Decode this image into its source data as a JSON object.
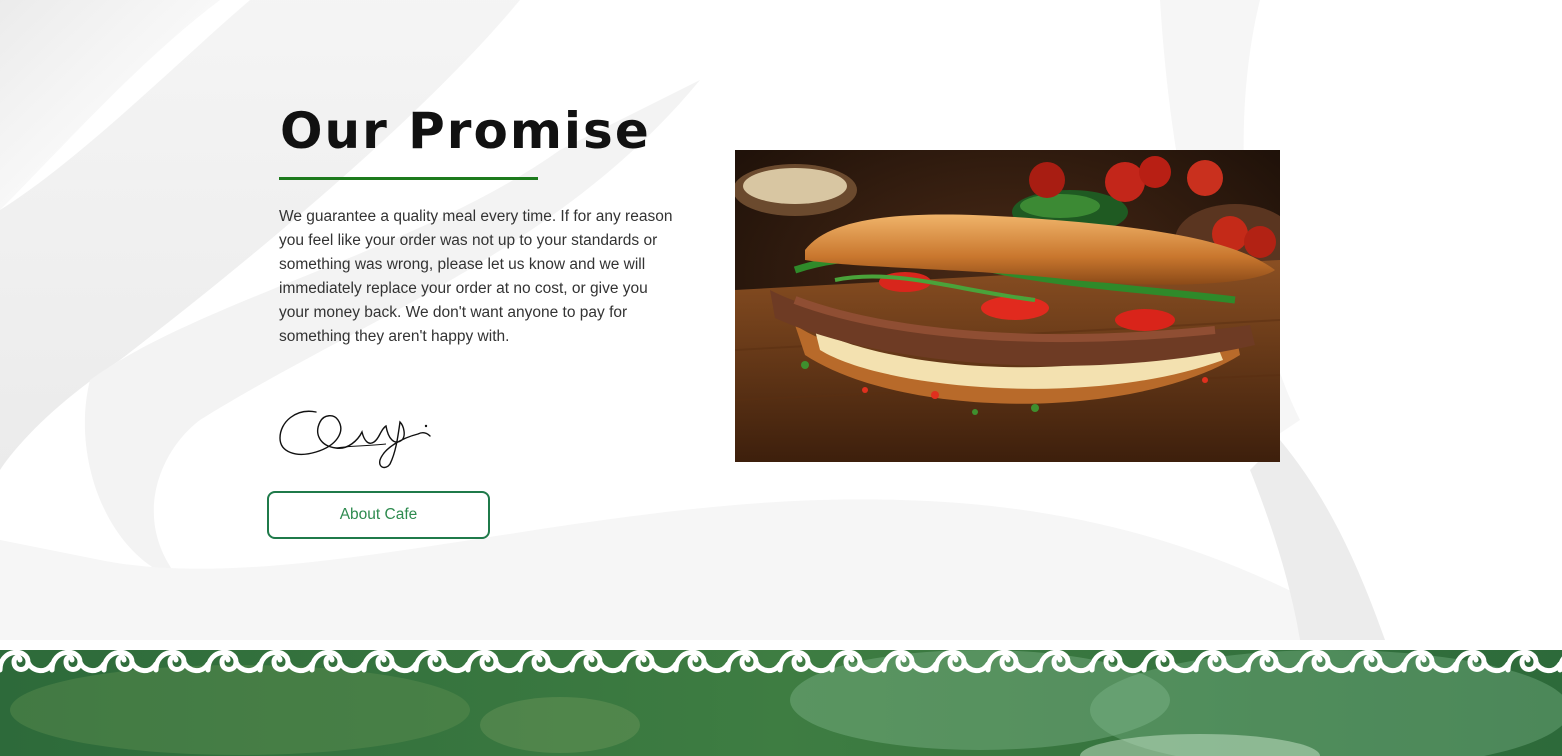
{
  "section": {
    "title": "Our Promise",
    "body": "We guarantee a quality meal every time. If for any reason you feel like your order was not up to your standards or something was wrong, please let us know and we will immediately replace your order at no cost, or give you your money back. We don't want anyone to pay for something they aren't happy with.",
    "signature": "Giovanni Salvia",
    "button_label": "About Cafe"
  },
  "image": {
    "subject": "steak and cheese sub sandwich on a wooden board"
  },
  "colors": {
    "accent_green": "#1c7a1c",
    "button_border": "#1f7a4a",
    "button_text": "#2e8b4f",
    "footer_green": "#2e6b3f"
  }
}
